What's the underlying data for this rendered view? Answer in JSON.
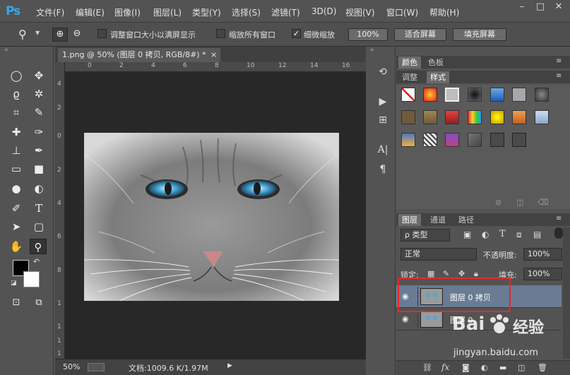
{
  "app": {
    "logo": "Ps"
  },
  "menubar": {
    "items": [
      "文件(F)",
      "编辑(E)",
      "图像(I)",
      "图层(L)",
      "类型(Y)",
      "选择(S)",
      "滤镜(T)",
      "3D(D)",
      "视图(V)",
      "窗口(W)",
      "帮助(H)"
    ],
    "window_controls": [
      "–",
      "□",
      "✕"
    ]
  },
  "options": {
    "resize_windows": "调整窗口大小以满屏显示",
    "zoom_all": "缩放所有窗口",
    "scrubby_zoom": "细微缩放",
    "zoom_100": "100%",
    "fit_screen": "适合屏幕",
    "fill_screen": "填充屏幕"
  },
  "document": {
    "tab_title": "1.png @ 50% (图层 0 拷贝, RGB/8#) *",
    "tab_close": "×",
    "ruler_h": [
      "0",
      "2",
      "4",
      "6",
      "8",
      "10",
      "12",
      "14",
      "16",
      "18"
    ],
    "ruler_v": [
      "4",
      "2",
      "0",
      "2",
      "4",
      "6",
      "8",
      "1",
      "1",
      "1",
      "1"
    ]
  },
  "status": {
    "zoom": "50%",
    "doc_info": "文档:1009.6 K/1.97M"
  },
  "panels": {
    "color_tabs": [
      "颜色",
      "色板"
    ],
    "style_tabs": [
      "调整",
      "样式"
    ],
    "layer_tabs": [
      "图层",
      "通道",
      "路径"
    ],
    "kind_filter": "ρ 类型",
    "blend_mode": "正常",
    "opacity_label": "不透明度:",
    "opacity_value": "100%",
    "lock_label": "锁定:",
    "fill_label": "填充:",
    "fill_value": "100%"
  },
  "layers": [
    {
      "name": "图层 0 拷贝",
      "selected": true
    },
    {
      "name": "图层 0",
      "selected": false
    }
  ],
  "watermark": {
    "brand": "Bai",
    "site": "经验",
    "url": "jingyan.baidu.com"
  },
  "colors": {
    "accent": "#32a8f0",
    "selection": "#6a7b93",
    "highlight": "#e32b2b"
  }
}
